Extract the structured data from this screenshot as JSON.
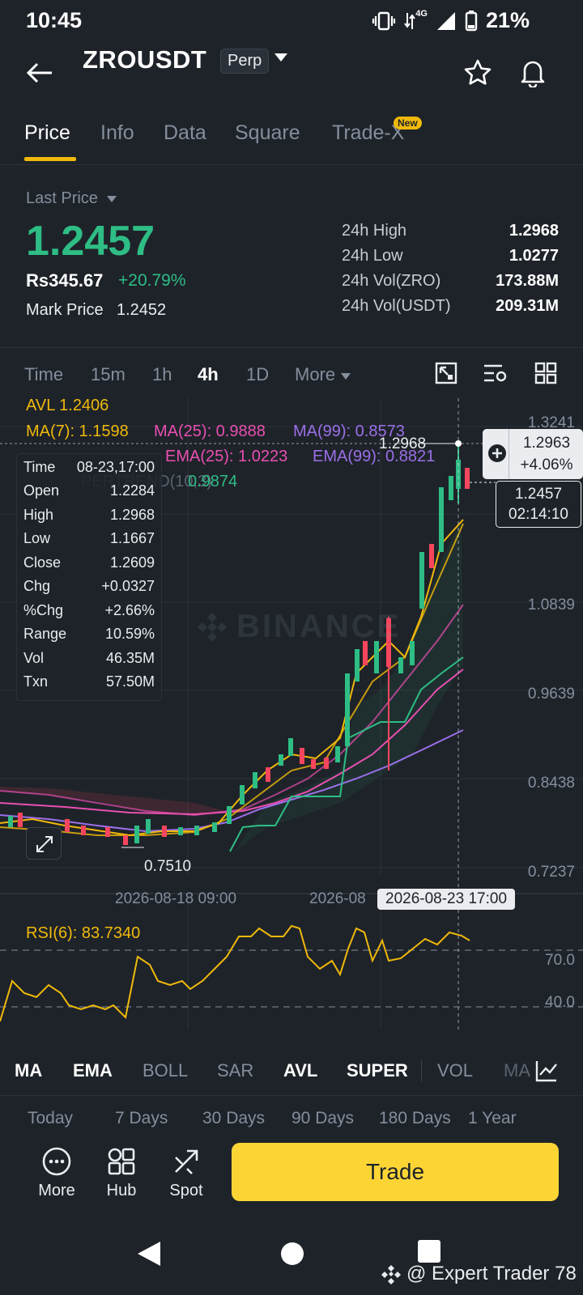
{
  "status_bar": {
    "time": "10:45",
    "network": "4G",
    "battery": "21%"
  },
  "header": {
    "symbol": "ZROUSDT",
    "contract_type": "Perp"
  },
  "tabs": [
    {
      "label": "Price"
    },
    {
      "label": "Info"
    },
    {
      "label": "Data"
    },
    {
      "label": "Square"
    },
    {
      "label": "Trade-X"
    }
  ],
  "new_badge": "New",
  "price": {
    "last_price_label": "Last Price",
    "last_price": "1.2457",
    "fiat_price": "Rs345.67",
    "change_pct": "+20.79%",
    "mark_price_label": "Mark Price",
    "mark_price": "1.2452",
    "stats": [
      {
        "label": "24h High",
        "value": "1.2968"
      },
      {
        "label": "24h Low",
        "value": "1.0277"
      },
      {
        "label": "24h Vol(ZRO)",
        "value": "173.88M"
      },
      {
        "label": "24h Vol(USDT)",
        "value": "209.31M"
      }
    ]
  },
  "timeframes": [
    {
      "label": "Time"
    },
    {
      "label": "15m"
    },
    {
      "label": "1h"
    },
    {
      "label": "4h"
    },
    {
      "label": "1D"
    },
    {
      "label": "More"
    }
  ],
  "indicators_overlay": {
    "avl": "AVL 1.2406",
    "ma7": "MA(7): 1.1598",
    "ma25": "MA(25): 0.9888",
    "ma99": "MA(99): 0.8573",
    "ema25": "EMA(25): 1.0223",
    "ema99": "EMA(99): 0.8821",
    "supertrend_value": "0.9874",
    "supertrend_partial": "PERTREND(10,3)"
  },
  "ohlc_tooltip": [
    {
      "k": "Time",
      "v": "08-23,17:00"
    },
    {
      "k": "Open",
      "v": "1.2284"
    },
    {
      "k": "High",
      "v": "1.2968"
    },
    {
      "k": "Low",
      "v": "1.1667"
    },
    {
      "k": "Close",
      "v": "1.2609"
    },
    {
      "k": "Chg",
      "v": "+0.0327"
    },
    {
      "k": "%Chg",
      "v": "+2.66%"
    },
    {
      "k": "Range",
      "v": "10.59%"
    },
    {
      "k": "Vol",
      "v": "46.35M"
    },
    {
      "k": "Txn",
      "v": "57.50M"
    }
  ],
  "y_axis": [
    "1.3241",
    "1.0839",
    "0.9639",
    "0.8438",
    "0.7237"
  ],
  "chart_labels": {
    "high_marker": "1.2968",
    "low_marker": "0.7510",
    "crosshair_price": "1.2963",
    "crosshair_pct": "+4.06%",
    "current_price": "1.2457",
    "countdown": "02:14:10",
    "watermark": "BINANCE"
  },
  "x_axis": {
    "label1": "2026-08-18 09:00",
    "label2": "2026-08",
    "crosshair_time": "2026-08-23 17:00"
  },
  "rsi": {
    "label": "RSI(6): 83.7340",
    "level_high": "70.0",
    "level_low": "40.0"
  },
  "indicator_tabs": [
    {
      "label": "MA",
      "on": true
    },
    {
      "label": "EMA",
      "on": true
    },
    {
      "label": "BOLL",
      "on": false
    },
    {
      "label": "SAR",
      "on": false
    },
    {
      "label": "AVL",
      "on": true
    },
    {
      "label": "SUPER",
      "on": true
    },
    {
      "label": "VOL",
      "on": false
    },
    {
      "label": "MA",
      "on": false
    }
  ],
  "ranges": [
    {
      "label": "Today"
    },
    {
      "label": "7 Days"
    },
    {
      "label": "30 Days"
    },
    {
      "label": "90 Days"
    },
    {
      "label": "180 Days"
    },
    {
      "label": "1 Year"
    }
  ],
  "bottom_bar": {
    "more": "More",
    "hub": "Hub",
    "spot": "Spot",
    "trade": "Trade"
  },
  "watermark_text": "@ Expert Trader 78",
  "colors": {
    "up": "#2ebd85",
    "down": "#f6465d",
    "accent": "#fcd535",
    "bg": "#1e2329"
  }
}
